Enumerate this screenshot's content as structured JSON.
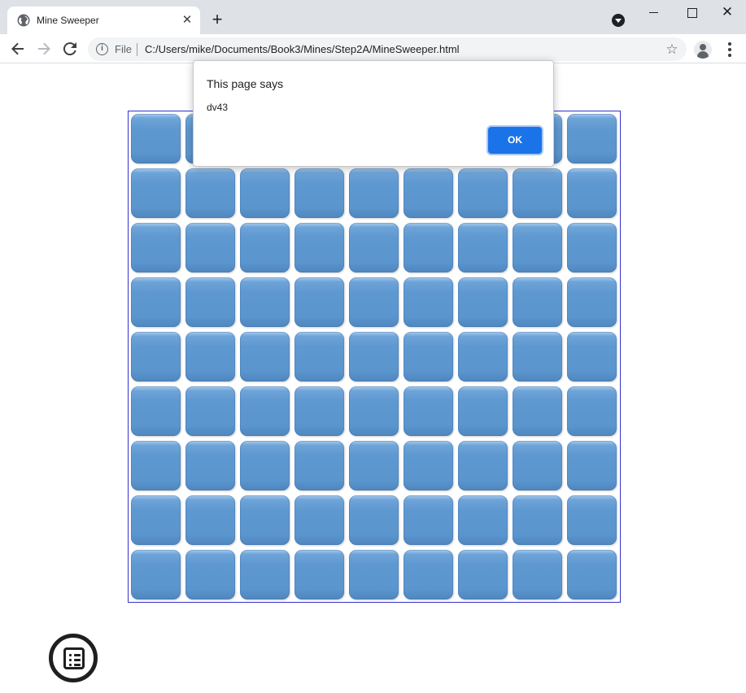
{
  "browser": {
    "tab_title": "Mine Sweeper",
    "tab_close_glyph": "✕",
    "new_tab_glyph": "+",
    "close_window_glyph": "✕",
    "scheme_label": "File",
    "url": "C:/Users/mike/Documents/Book3/Mines/Step2A/MineSweeper.html",
    "icons": [
      "globe-icon",
      "back-arrow-icon",
      "forward-arrow-icon",
      "reload-icon",
      "info-icon",
      "star-icon",
      "account-icon",
      "more-menu-icon"
    ]
  },
  "game": {
    "rows": 9,
    "columns": 9,
    "cell_color": "#5e98d0",
    "board_border_color": "#3333cc",
    "menu_icon": "list-menu-icon"
  },
  "dialog": {
    "title": "This page says",
    "message": "dv43",
    "ok_label": "OK",
    "ok_color": "#1a73e8"
  }
}
